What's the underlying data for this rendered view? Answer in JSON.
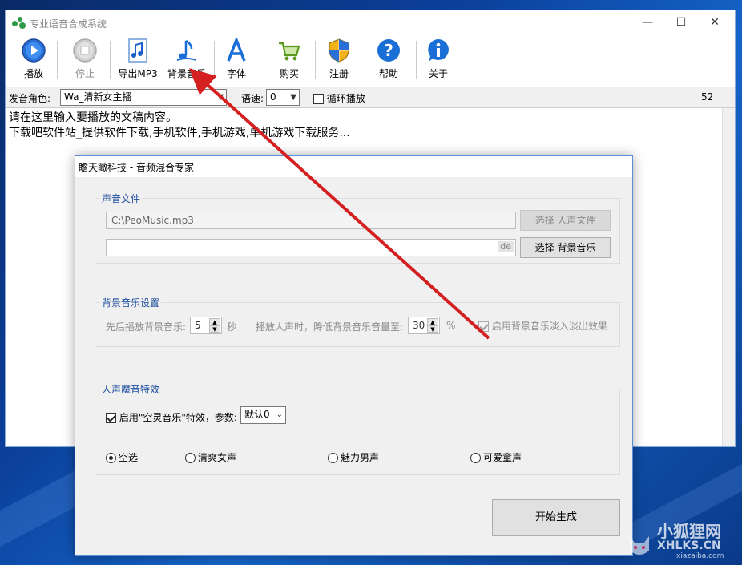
{
  "main_window": {
    "title": "专业语音合成系统",
    "controls": {
      "minimize": "—",
      "maximize": "☐",
      "close": "✕"
    }
  },
  "toolbar": {
    "items": [
      {
        "label": "播放",
        "icon": "play-icon"
      },
      {
        "label": "停止",
        "icon": "stop-icon"
      },
      {
        "label": "导出MP3",
        "icon": "music-note-icon"
      },
      {
        "label": "背景音乐",
        "icon": "music-note-icon"
      },
      {
        "label": "字体",
        "icon": "font-icon"
      },
      {
        "label": "购买",
        "icon": "cart-icon"
      },
      {
        "label": "注册",
        "icon": "shield-icon"
      },
      {
        "label": "帮助",
        "icon": "help-icon"
      },
      {
        "label": "关于",
        "icon": "info-icon"
      }
    ]
  },
  "options": {
    "voice_label": "发音角色:",
    "voice_value": "Wa_清新女主播",
    "speed_label": "语速:",
    "speed_value": "0",
    "loop_label": "循环播放",
    "count": "52"
  },
  "editor": {
    "line1": "请在这里输入要播放的文稿内容。",
    "line2": "下载吧软件站_提供软件下载,手机软件,手机游戏,单机游戏下载服务..."
  },
  "dialog": {
    "title": "瞻天瞰科技 - 音频混合专家",
    "close": "✕",
    "sound_group": {
      "title": "声音文件",
      "voice_file": "C:\\PeoMusic.mp3",
      "voice_btn": "选择 人声文件",
      "bg_file": "",
      "bg_tag": "de",
      "bg_btn": "选择 背景音乐"
    },
    "bg_group": {
      "title": "背景音乐设置",
      "delay_label": "先后播放背景音乐:",
      "delay_value": "5",
      "delay_unit": "秒",
      "reduce_label": "播放人声时，降低背景音乐音量至:",
      "reduce_value": "30",
      "reduce_unit": "%",
      "fade_label": "启用背景音乐淡入淡出效果"
    },
    "effect_group": {
      "title": "人声魔音特效",
      "enable_label": "启用\"空灵音乐\"特效，参数:",
      "param_value": "默认0",
      "radios": [
        "空选",
        "清爽女声",
        "魅力男声",
        "可爱童声"
      ],
      "selected": "空选"
    },
    "start_btn": "开始生成"
  },
  "watermark": {
    "line1": "小狐狸网",
    "line2": "XHLKS.CN",
    "line3": "xiazaiba.com"
  },
  "colors": {
    "arrow": "#d42020",
    "accent": "#1f4fa0"
  }
}
